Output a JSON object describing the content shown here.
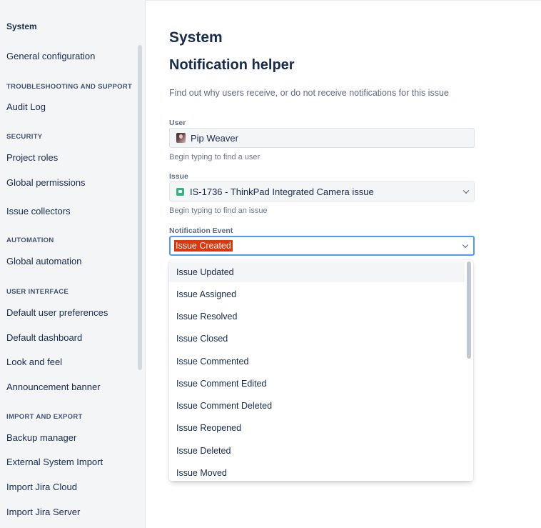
{
  "sidebar": {
    "heading": "System",
    "general": "General configuration",
    "sections": {
      "troubleshooting": "TROUBLESHOOTING AND SUPPORT",
      "security": "SECURITY",
      "automation": "AUTOMATION",
      "user_interface": "USER INTERFACE",
      "import_export": "IMPORT AND EXPORT"
    },
    "items": {
      "audit_log": "Audit Log",
      "project_roles": "Project roles",
      "global_permissions": "Global permissions",
      "issue_collectors": "Issue collectors",
      "global_automation": "Global automation",
      "default_user_preferences": "Default user preferences",
      "default_dashboard": "Default dashboard",
      "look_and_feel": "Look and feel",
      "announcement_banner": "Announcement banner",
      "backup_manager": "Backup manager",
      "external_system_import": "External System Import",
      "import_jira_cloud": "Import Jira Cloud",
      "import_jira_server": "Import Jira Server"
    }
  },
  "main": {
    "title": "System",
    "subtitle": "Notification helper",
    "description": "Find out why users receive, or do not receive notifications for this issue"
  },
  "form": {
    "user_label": "User",
    "user_value": "Pip Weaver",
    "user_help": "Begin typing to find a user",
    "issue_label": "Issue",
    "issue_value": "IS-1736 - ThinkPad Integrated Camera issue",
    "issue_help": "Begin typing to find an issue",
    "event_label": "Notification Event",
    "event_value": "Issue Created"
  },
  "dropdown": {
    "options": [
      "Issue Updated",
      "Issue Assigned",
      "Issue Resolved",
      "Issue Closed",
      "Issue Commented",
      "Issue Comment Edited",
      "Issue Comment Deleted",
      "Issue Reopened",
      "Issue Deleted",
      "Issue Moved"
    ]
  },
  "colors": {
    "accent": "#4C9AFF",
    "selection": "#DE350B",
    "story": "#36B37E"
  }
}
